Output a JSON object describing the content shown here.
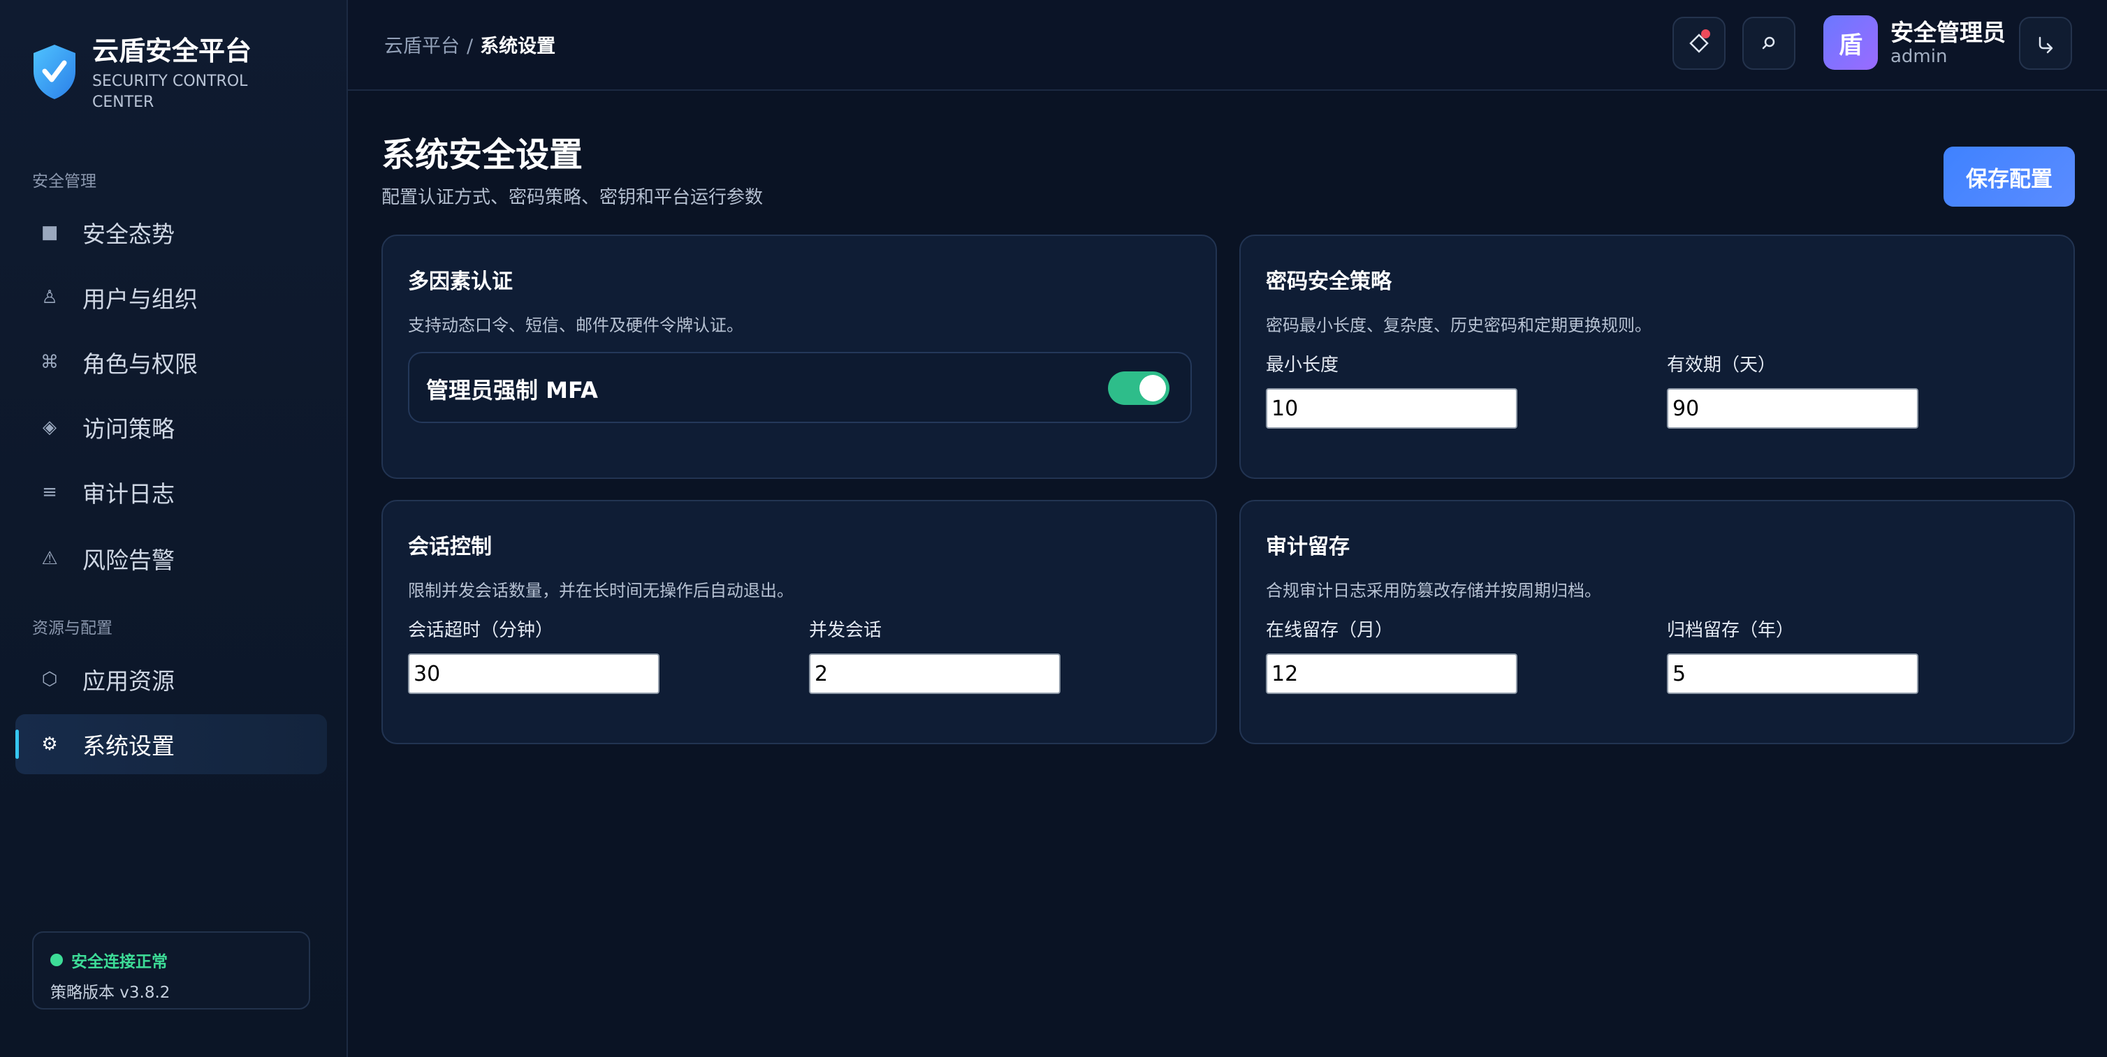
{
  "brand": {
    "title": "云盾安全平台",
    "subtitle": "SECURITY CONTROL CENTER"
  },
  "sidebar": {
    "sections": [
      {
        "label": "安全管理"
      },
      {
        "label": "资源与配置"
      }
    ],
    "items": [
      {
        "label": "安全态势",
        "icon": "■"
      },
      {
        "label": "用户与组织",
        "icon": "♙"
      },
      {
        "label": "角色与权限",
        "icon": "⌘"
      },
      {
        "label": "访问策略",
        "icon": "◈"
      },
      {
        "label": "审计日志",
        "icon": "≡"
      },
      {
        "label": "风险告警",
        "icon": "⚠"
      },
      {
        "label": "应用资源",
        "icon": "⬡"
      },
      {
        "label": "系统设置",
        "icon": "⚙"
      }
    ],
    "active_item": "系统设置",
    "status": {
      "text": "安全连接正常",
      "version": "策略版本 v3.8.2",
      "color": "#3ddc97"
    }
  },
  "header": {
    "breadcrumb": {
      "root": "云盾平台",
      "separator": "/",
      "current": "系统设置"
    },
    "user": {
      "avatar_text": "盾",
      "name": "安全管理员",
      "role": "admin"
    }
  },
  "page": {
    "title": "系统安全设置",
    "subtitle": "配置认证方式、密码策略、密钥和平台运行参数",
    "save_label": "保存配置"
  },
  "cards": {
    "mfa": {
      "title": "多因素认证",
      "desc": "支持动态口令、短信、邮件及硬件令牌认证。",
      "toggle_label": "管理员强制 MFA",
      "toggle_on": true
    },
    "password": {
      "title": "密码安全策略",
      "desc": "密码最小长度、复杂度、历史密码和定期更换规则。",
      "fields": [
        {
          "label": "最小长度",
          "value": "10"
        },
        {
          "label": "有效期（天）",
          "value": "90"
        }
      ]
    },
    "session": {
      "title": "会话控制",
      "desc": "限制并发会话数量，并在长时间无操作后自动退出。",
      "fields": [
        {
          "label": "会话超时（分钟）",
          "value": "30"
        },
        {
          "label": "并发会话",
          "value": "2"
        }
      ]
    },
    "audit": {
      "title": "审计留存",
      "desc": "合规审计日志采用防篡改存储并按周期归档。",
      "fields": [
        {
          "label": "在线留存（月）",
          "value": "12"
        },
        {
          "label": "归档留存（年）",
          "value": "5"
        }
      ]
    }
  },
  "colors": {
    "accent": "#3f82ff",
    "toggle_on": "#2ebd8a",
    "alert": "#ef4b5b",
    "background": "#0a1324"
  }
}
